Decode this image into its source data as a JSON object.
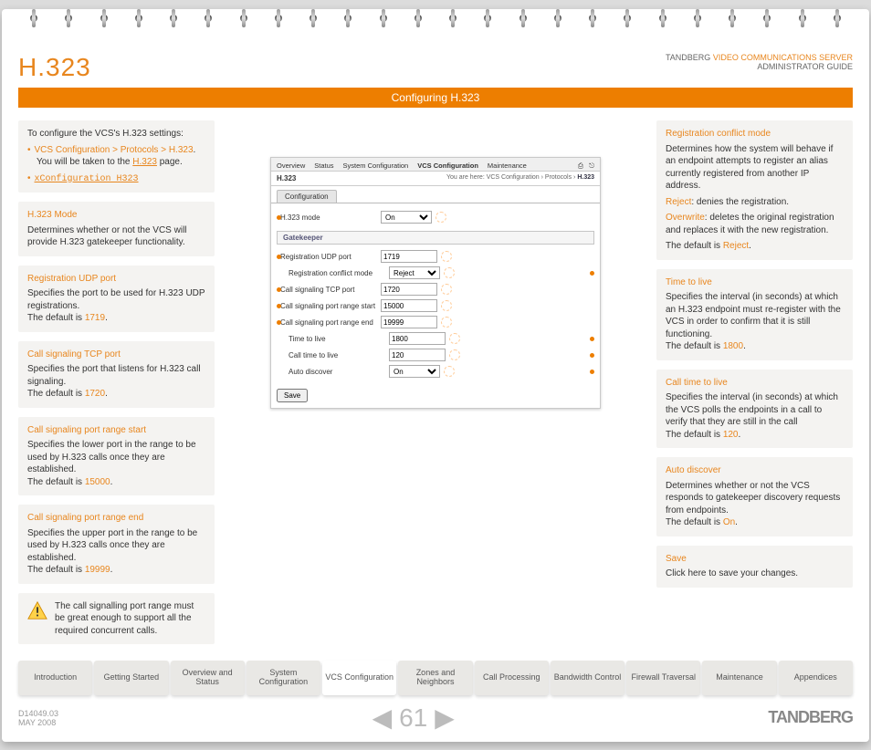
{
  "header": {
    "title": "H.323",
    "brand_prefix": "TANDBERG",
    "brand_product": "VIDEO COMMUNICATIONS SERVER",
    "brand_sub": "ADMINISTRATOR GUIDE"
  },
  "bar_title": "Configuring H.323",
  "intro": {
    "lead": "To configure the VCS's H.323 settings:",
    "path": "VCS Configuration > Protocols > H.323",
    "path_tail": "You will be  taken to the ",
    "path_link": "H.323",
    "path_end": " page.",
    "xconf": "xConfiguration H323"
  },
  "left": {
    "mode_t": "H.323 Mode",
    "mode_b": "Determines whether or not the VCS will provide H.323 gatekeeper functionality.",
    "udp_t": "Registration UDP port",
    "udp_b": "Specifies the port to be used for H.323 UDP registrations.",
    "udp_d": "The default is ",
    "udp_v": "1719",
    "tcp_t": "Call signaling TCP port",
    "tcp_b": "Specifies the port that listens for H.323 call signaling.",
    "tcp_d": "The default is ",
    "tcp_v": "1720",
    "ps_t": "Call signaling port range start",
    "ps_b": "Specifies the lower port in the range to be used by H.323 calls once they are established.",
    "ps_d": "The default is ",
    "ps_v": "15000",
    "pe_t": "Call signaling port range end",
    "pe_b": "Specifies the upper port in the range to be used by H.323 calls once they are established.",
    "pe_d": "The default is ",
    "pe_v": "19999",
    "note": "The call signalling port range must be great enough to support all the required concurrent calls."
  },
  "right": {
    "rc_t": "Registration conflict mode",
    "rc_b": "Determines how the system will behave if an endpoint attempts to register an alias currently registered from another IP address.",
    "rc_r1": "Reject",
    "rc_r1b": ": denies the registration.",
    "rc_r2": "Overwrite",
    "rc_r2b": ": deletes the original registration and replaces it with the new registration.",
    "rc_d": "The default is ",
    "rc_v": "Reject",
    "ttl_t": "Time to live",
    "ttl_b": "Specifies the interval (in seconds) at which an H.323 endpoint must re-register with the VCS in order to confirm that it is still functioning.",
    "ttl_d": "The default is ",
    "ttl_v": "1800",
    "cttl_t": "Call time to live",
    "cttl_b": "Specifies the interval (in seconds) at which the VCS polls the endpoints in a call to verify that they are still in the call",
    "cttl_d": "The default is ",
    "cttl_v": "120",
    "ad_t": "Auto discover",
    "ad_b": "Determines whether or not the VCS responds to gatekeeper discovery requests from endpoints.",
    "ad_d": "The default is ",
    "ad_v": "On",
    "save_t": "Save",
    "save_b": "Click here to save your changes."
  },
  "shot": {
    "tabs": [
      "Overview",
      "Status",
      "System Configuration",
      "VCS Configuration",
      "Maintenance"
    ],
    "title": "H.323",
    "crumb_pre": "You are here:",
    "crumb": " VCS Configuration › Protocols › ",
    "crumb_end": "H.323",
    "subtab": "Configuration",
    "sec_gk": "Gatekeeper",
    "rows": {
      "mode": {
        "l": "H.323 mode",
        "v": "On",
        "type": "sel"
      },
      "udp": {
        "l": "Registration UDP port",
        "v": "1719",
        "type": "txt"
      },
      "conf": {
        "l": "Registration conflict mode",
        "v": "Reject",
        "type": "sel"
      },
      "tcp": {
        "l": "Call signaling TCP port",
        "v": "1720",
        "type": "txt"
      },
      "ps": {
        "l": "Call signaling port range start",
        "v": "15000",
        "type": "txt"
      },
      "pe": {
        "l": "Call signaling port range end",
        "v": "19999",
        "type": "txt"
      },
      "ttl": {
        "l": "Time to live",
        "v": "1800",
        "type": "txt"
      },
      "cttl": {
        "l": "Call time to live",
        "v": "120",
        "type": "txt"
      },
      "ad": {
        "l": "Auto discover",
        "v": "On",
        "type": "sel"
      }
    },
    "save": "Save"
  },
  "nav": [
    "Introduction",
    "Getting Started",
    "Overview and Status",
    "System Configuration",
    "VCS Configuration",
    "Zones and Neighbors",
    "Call Processing",
    "Bandwidth Control",
    "Firewall Traversal",
    "Maintenance",
    "Appendices"
  ],
  "footer": {
    "doc": "D14049.03",
    "date": "MAY 2008",
    "page": "61",
    "logo": "TANDBERG"
  }
}
